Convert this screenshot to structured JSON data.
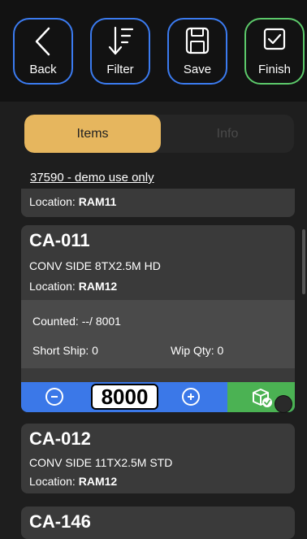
{
  "toolbar": {
    "back": "Back",
    "filter": "Filter",
    "save": "Save",
    "finish": "Finish"
  },
  "tabs": {
    "items": "Items",
    "info": "Info"
  },
  "document": {
    "link": "37590 - demo use only"
  },
  "location_label": "Location:",
  "previous_item": {
    "location": "RAM11"
  },
  "active_item": {
    "code": "CA-011",
    "description": "CONV SIDE 8TX2.5M HD",
    "location": "RAM12",
    "counted": "Counted: --/ 8001",
    "short_ship": "Short Ship: 0",
    "wip_qty": "Wip Qty: 0",
    "quantity": "8000"
  },
  "next_item": {
    "code": "CA-012",
    "description": "CONV SIDE 11TX2.5M STD",
    "location": "RAM12"
  },
  "last_item": {
    "code": "CA-146"
  },
  "icons": {
    "back": "chevron-left-icon",
    "filter": "filter-sort-icon",
    "save": "floppy-disk-icon",
    "finish": "checkbox-icon",
    "minus": "minus-circle-icon",
    "plus": "plus-circle-icon",
    "confirm": "box-check-icon"
  },
  "colors": {
    "accent_blue": "#3b7bf0",
    "accent_green": "#5cc96a",
    "tab_active": "#e6b65e",
    "qty_bar": "#3b78e8",
    "confirm_green": "#4bb253"
  }
}
